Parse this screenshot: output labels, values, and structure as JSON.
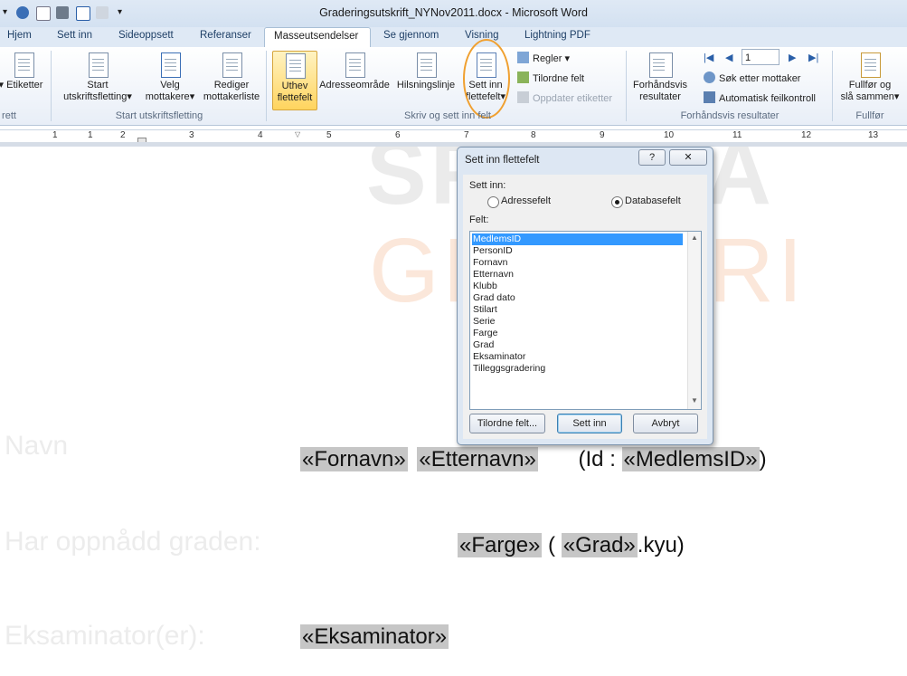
{
  "window": {
    "title": "Graderingsutskrift_NYNov2011.docx - Microsoft Word"
  },
  "tabs": [
    "Hjem",
    "Sett inn",
    "Sideoppsett",
    "Referanser",
    "Masseutsendelser",
    "Se gjennom",
    "Visning",
    "Lightning PDF"
  ],
  "ribbon": {
    "etiketter": "Etiketter",
    "etiketter_group": "rett",
    "start_l1": "Start",
    "start_l2": "utskriftsfletting",
    "velg_l1": "Velg",
    "velg_l2": "mottakere",
    "rediger_l1": "Rediger",
    "rediger_l2": "mottakerliste",
    "group1": "Start utskriftsfletting",
    "uthev_l1": "Uthev",
    "uthev_l2": "flettefelt",
    "adresse": "Adresseområde",
    "hilsning": "Hilsningslinje",
    "settinn_l1": "Sett inn",
    "settinn_l2": "flettefelt",
    "regler": "Regler",
    "tilordne": "Tilordne felt",
    "oppdater": "Oppdater etiketter",
    "group2": "Skriv og sett inn felt",
    "preview_l1": "Forhåndsvis",
    "preview_l2": "resultater",
    "record": "1",
    "sok": "Søk etter mottaker",
    "feil": "Automatisk feilkontroll",
    "group3": "Forhåndsvis resultater",
    "fullfor_l1": "Fullfør og",
    "fullfor_l2": "slå sammen",
    "group4": "Fullfør"
  },
  "ruler": [
    "1",
    "1",
    "2",
    "3",
    "4",
    "5",
    "6",
    "7",
    "8",
    "9",
    "10",
    "11",
    "12",
    "13"
  ],
  "document": {
    "watermark1": "SPORKA",
    "watermark2": "GRADERI",
    "label_navn": "Navn",
    "label_grad": "Har oppnådd graden:",
    "label_eks": "Eksaminator(er):",
    "fornavn": "«Fornavn»",
    "etternavn": "«Etternavn»",
    "id_prefix": "(Id : ",
    "medlemsid": "«MedlemsID»",
    "id_suffix": ")",
    "farge": "«Farge»",
    "grad_open": " ( ",
    "grad": "«Grad»",
    "kyu": ".kyu)",
    "eksaminator": "«Eksaminator»"
  },
  "dialog": {
    "title": "Sett inn flettefelt",
    "help": "?",
    "close": "✕",
    "settinn_label": "Sett inn:",
    "opt_adresse": "Adressefelt",
    "opt_database": "Databasefelt",
    "felt_label": "Felt:",
    "fields": [
      "MedlemsID",
      "PersonID",
      "Fornavn",
      "Etternavn",
      "Klubb",
      "Grad dato",
      "Stilart",
      "Serie",
      "Farge",
      "Grad",
      "Eksaminator",
      "Tilleggsgradering"
    ],
    "btn_tilordne": "Tilordne felt...",
    "btn_settinn": "Sett inn",
    "btn_avbryt": "Avbryt"
  },
  "colors": {
    "accent_orange": "#f0a030",
    "selection": "#3399ff",
    "merge_field_bg": "#c6c6c6"
  }
}
